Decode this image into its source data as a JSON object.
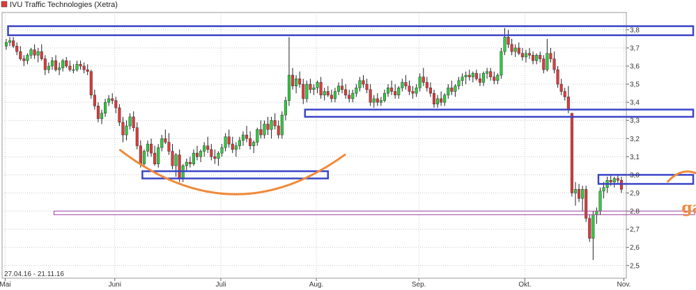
{
  "chart_data": {
    "type": "candlestick",
    "title": "IVU Traffic Technologies (Xetra)",
    "date_range_label": "27.04.16 - 21.11.16",
    "ylim": [
      2.43,
      3.88
    ],
    "y_ticks": [
      2.5,
      2.6,
      2.7,
      2.8,
      2.9,
      3.0,
      3.1,
      3.2,
      3.3,
      3.4,
      3.5,
      3.6,
      3.7,
      3.8
    ],
    "y_tick_labels": [
      "2,5",
      "2,6",
      "2,7",
      "2,8",
      "2,9",
      "3,0",
      "3,1",
      "3,2",
      "3,3",
      "3,4",
      "3,5",
      "3,6",
      "3,7",
      "3,8"
    ],
    "x_months": [
      {
        "label": "Mai",
        "index": 0
      },
      {
        "label": "Juni",
        "index": 31
      },
      {
        "label": "Juli",
        "index": 61
      },
      {
        "label": "Aug.",
        "index": 88
      },
      {
        "label": "Sep.",
        "index": 117
      },
      {
        "label": "Okt.",
        "index": 147
      },
      {
        "label": "Nov.",
        "index": 175
      }
    ],
    "candles": [
      [
        3.71,
        3.75,
        3.69,
        3.73
      ],
      [
        3.73,
        3.76,
        3.71,
        3.74
      ],
      [
        3.74,
        3.76,
        3.7,
        3.71
      ],
      [
        3.71,
        3.73,
        3.66,
        3.68
      ],
      [
        3.68,
        3.71,
        3.63,
        3.64
      ],
      [
        3.64,
        3.66,
        3.6,
        3.63
      ],
      [
        3.63,
        3.67,
        3.61,
        3.66
      ],
      [
        3.66,
        3.7,
        3.64,
        3.69
      ],
      [
        3.69,
        3.72,
        3.64,
        3.66
      ],
      [
        3.66,
        3.7,
        3.62,
        3.68
      ],
      [
        3.68,
        3.72,
        3.63,
        3.64
      ],
      [
        3.64,
        3.66,
        3.55,
        3.58
      ],
      [
        3.58,
        3.62,
        3.56,
        3.6
      ],
      [
        3.6,
        3.65,
        3.58,
        3.63
      ],
      [
        3.63,
        3.66,
        3.57,
        3.58
      ],
      [
        3.58,
        3.62,
        3.55,
        3.59
      ],
      [
        3.59,
        3.64,
        3.57,
        3.63
      ],
      [
        3.63,
        3.65,
        3.59,
        3.6
      ],
      [
        3.6,
        3.63,
        3.57,
        3.58
      ],
      [
        3.58,
        3.61,
        3.56,
        3.58
      ],
      [
        3.58,
        3.63,
        3.57,
        3.61
      ],
      [
        3.61,
        3.63,
        3.58,
        3.6
      ],
      [
        3.6,
        3.62,
        3.56,
        3.58
      ],
      [
        3.58,
        3.61,
        3.55,
        3.57
      ],
      [
        3.57,
        3.58,
        3.42,
        3.44
      ],
      [
        3.44,
        3.47,
        3.36,
        3.38
      ],
      [
        3.38,
        3.4,
        3.29,
        3.31
      ],
      [
        3.31,
        3.36,
        3.28,
        3.34
      ],
      [
        3.34,
        3.42,
        3.32,
        3.4
      ],
      [
        3.4,
        3.44,
        3.38,
        3.42
      ],
      [
        3.42,
        3.45,
        3.39,
        3.41
      ],
      [
        3.41,
        3.43,
        3.34,
        3.37
      ],
      [
        3.37,
        3.39,
        3.27,
        3.29
      ],
      [
        3.29,
        3.32,
        3.18,
        3.22
      ],
      [
        3.22,
        3.3,
        3.19,
        3.27
      ],
      [
        3.27,
        3.34,
        3.25,
        3.32
      ],
      [
        3.32,
        3.35,
        3.24,
        3.26
      ],
      [
        3.26,
        3.29,
        3.14,
        3.16
      ],
      [
        3.16,
        3.19,
        3.04,
        3.06
      ],
      [
        3.06,
        3.14,
        3.04,
        3.13
      ],
      [
        3.13,
        3.19,
        3.1,
        3.17
      ],
      [
        3.17,
        3.2,
        3.1,
        3.12
      ],
      [
        3.12,
        3.16,
        3.05,
        3.06
      ],
      [
        3.06,
        3.17,
        3.04,
        3.15
      ],
      [
        3.15,
        3.22,
        3.13,
        3.2
      ],
      [
        3.2,
        3.25,
        3.17,
        3.18
      ],
      [
        3.18,
        3.23,
        3.11,
        3.13
      ],
      [
        3.13,
        3.17,
        3.03,
        3.05
      ],
      [
        3.05,
        3.12,
        2.99,
        3.11
      ],
      [
        3.11,
        3.14,
        2.96,
        2.98
      ],
      [
        2.98,
        3.06,
        2.96,
        3.05
      ],
      [
        3.05,
        3.09,
        3.02,
        3.07
      ],
      [
        3.07,
        3.1,
        3.04,
        3.06
      ],
      [
        3.06,
        3.14,
        3.05,
        3.12
      ],
      [
        3.12,
        3.16,
        3.08,
        3.1
      ],
      [
        3.1,
        3.14,
        3.07,
        3.13
      ],
      [
        3.13,
        3.18,
        3.1,
        3.16
      ],
      [
        3.16,
        3.21,
        3.12,
        3.14
      ],
      [
        3.14,
        3.17,
        3.08,
        3.1
      ],
      [
        3.1,
        3.14,
        3.06,
        3.09
      ],
      [
        3.09,
        3.13,
        3.05,
        3.12
      ],
      [
        3.12,
        3.17,
        3.1,
        3.15
      ],
      [
        3.15,
        3.23,
        3.13,
        3.21
      ],
      [
        3.21,
        3.25,
        3.15,
        3.17
      ],
      [
        3.17,
        3.21,
        3.12,
        3.14
      ],
      [
        3.14,
        3.18,
        3.1,
        3.16
      ],
      [
        3.16,
        3.21,
        3.14,
        3.19
      ],
      [
        3.19,
        3.24,
        3.16,
        3.22
      ],
      [
        3.22,
        3.27,
        3.18,
        3.2
      ],
      [
        3.2,
        3.24,
        3.14,
        3.16
      ],
      [
        3.16,
        3.19,
        3.12,
        3.18
      ],
      [
        3.18,
        3.26,
        3.16,
        3.25
      ],
      [
        3.25,
        3.3,
        3.2,
        3.22
      ],
      [
        3.22,
        3.3,
        3.2,
        3.28
      ],
      [
        3.28,
        3.32,
        3.22,
        3.25
      ],
      [
        3.25,
        3.32,
        3.2,
        3.3
      ],
      [
        3.3,
        3.34,
        3.25,
        3.27
      ],
      [
        3.27,
        3.3,
        3.2,
        3.22
      ],
      [
        3.22,
        3.35,
        3.2,
        3.33
      ],
      [
        3.33,
        3.43,
        3.3,
        3.41
      ],
      [
        3.41,
        3.76,
        3.38,
        3.55
      ],
      [
        3.55,
        3.59,
        3.47,
        3.49
      ],
      [
        3.49,
        3.55,
        3.45,
        3.53
      ],
      [
        3.53,
        3.57,
        3.48,
        3.5
      ],
      [
        3.5,
        3.53,
        3.39,
        3.42
      ],
      [
        3.42,
        3.52,
        3.4,
        3.5
      ],
      [
        3.5,
        3.53,
        3.45,
        3.47
      ],
      [
        3.47,
        3.5,
        3.44,
        3.48
      ],
      [
        3.48,
        3.52,
        3.45,
        3.51
      ],
      [
        3.51,
        3.54,
        3.42,
        3.44
      ],
      [
        3.44,
        3.48,
        3.41,
        3.46
      ],
      [
        3.46,
        3.49,
        3.43,
        3.44
      ],
      [
        3.44,
        3.47,
        3.4,
        3.42
      ],
      [
        3.42,
        3.48,
        3.4,
        3.46
      ],
      [
        3.46,
        3.51,
        3.44,
        3.49
      ],
      [
        3.49,
        3.53,
        3.45,
        3.47
      ],
      [
        3.47,
        3.5,
        3.42,
        3.44
      ],
      [
        3.44,
        3.47,
        3.4,
        3.42
      ],
      [
        3.42,
        3.47,
        3.4,
        3.45
      ],
      [
        3.45,
        3.5,
        3.43,
        3.48
      ],
      [
        3.48,
        3.54,
        3.46,
        3.52
      ],
      [
        3.52,
        3.55,
        3.48,
        3.5
      ],
      [
        3.5,
        3.53,
        3.45,
        3.47
      ],
      [
        3.47,
        3.5,
        3.38,
        3.4
      ],
      [
        3.4,
        3.44,
        3.37,
        3.42
      ],
      [
        3.42,
        3.45,
        3.38,
        3.4
      ],
      [
        3.4,
        3.43,
        3.38,
        3.41
      ],
      [
        3.41,
        3.47,
        3.4,
        3.45
      ],
      [
        3.45,
        3.5,
        3.43,
        3.48
      ],
      [
        3.48,
        3.52,
        3.44,
        3.46
      ],
      [
        3.46,
        3.5,
        3.42,
        3.44
      ],
      [
        3.44,
        3.49,
        3.42,
        3.48
      ],
      [
        3.48,
        3.53,
        3.46,
        3.51
      ],
      [
        3.51,
        3.55,
        3.47,
        3.49
      ],
      [
        3.49,
        3.52,
        3.44,
        3.46
      ],
      [
        3.46,
        3.49,
        3.42,
        3.45
      ],
      [
        3.45,
        3.5,
        3.43,
        3.48
      ],
      [
        3.48,
        3.56,
        3.46,
        3.54
      ],
      [
        3.54,
        3.59,
        3.49,
        3.51
      ],
      [
        3.51,
        3.54,
        3.46,
        3.48
      ],
      [
        3.48,
        3.51,
        3.43,
        3.45
      ],
      [
        3.45,
        3.47,
        3.37,
        3.39
      ],
      [
        3.39,
        3.44,
        3.37,
        3.42
      ],
      [
        3.42,
        3.46,
        3.38,
        3.4
      ],
      [
        3.4,
        3.45,
        3.38,
        3.44
      ],
      [
        3.44,
        3.5,
        3.42,
        3.48
      ],
      [
        3.48,
        3.52,
        3.44,
        3.46
      ],
      [
        3.46,
        3.5,
        3.43,
        3.49
      ],
      [
        3.49,
        3.54,
        3.47,
        3.52
      ],
      [
        3.52,
        3.56,
        3.49,
        3.54
      ],
      [
        3.54,
        3.57,
        3.5,
        3.55
      ],
      [
        3.55,
        3.58,
        3.52,
        3.54
      ],
      [
        3.54,
        3.57,
        3.51,
        3.56
      ],
      [
        3.56,
        3.58,
        3.52,
        3.53
      ],
      [
        3.53,
        3.56,
        3.49,
        3.51
      ],
      [
        3.51,
        3.57,
        3.49,
        3.56
      ],
      [
        3.56,
        3.59,
        3.53,
        3.57
      ],
      [
        3.57,
        3.59,
        3.52,
        3.54
      ],
      [
        3.54,
        3.57,
        3.5,
        3.52
      ],
      [
        3.52,
        3.56,
        3.5,
        3.55
      ],
      [
        3.55,
        3.7,
        3.53,
        3.68
      ],
      [
        3.68,
        3.81,
        3.66,
        3.76
      ],
      [
        3.76,
        3.8,
        3.7,
        3.72
      ],
      [
        3.72,
        3.75,
        3.66,
        3.68
      ],
      [
        3.68,
        3.72,
        3.65,
        3.7
      ],
      [
        3.7,
        3.73,
        3.66,
        3.67
      ],
      [
        3.67,
        3.7,
        3.63,
        3.65
      ],
      [
        3.65,
        3.69,
        3.62,
        3.67
      ],
      [
        3.67,
        3.7,
        3.64,
        3.66
      ],
      [
        3.66,
        3.68,
        3.61,
        3.63
      ],
      [
        3.63,
        3.67,
        3.61,
        3.66
      ],
      [
        3.66,
        3.68,
        3.62,
        3.64
      ],
      [
        3.64,
        3.66,
        3.56,
        3.58
      ],
      [
        3.58,
        3.75,
        3.57,
        3.67
      ],
      [
        3.67,
        3.7,
        3.62,
        3.64
      ],
      [
        3.64,
        3.68,
        3.56,
        3.58
      ],
      [
        3.58,
        3.6,
        3.48,
        3.5
      ],
      [
        3.5,
        3.53,
        3.44,
        3.46
      ],
      [
        3.46,
        3.48,
        3.41,
        3.43
      ],
      [
        3.43,
        3.49,
        3.34,
        3.36
      ],
      [
        3.34,
        3.34,
        2.88,
        2.9
      ],
      [
        2.9,
        2.96,
        2.83,
        2.92
      ],
      [
        2.92,
        2.95,
        2.85,
        2.87
      ],
      [
        2.87,
        2.94,
        2.8,
        2.92
      ],
      [
        2.92,
        2.94,
        2.74,
        2.76
      ],
      [
        2.76,
        2.78,
        2.63,
        2.65
      ],
      [
        2.65,
        2.8,
        2.53,
        2.78
      ],
      [
        2.78,
        2.82,
        2.73,
        2.8
      ],
      [
        2.8,
        2.93,
        2.78,
        2.91
      ],
      [
        2.91,
        2.96,
        2.87,
        2.93
      ],
      [
        2.93,
        2.99,
        2.9,
        2.97
      ],
      [
        2.97,
        3.0,
        2.94,
        2.96
      ],
      [
        2.96,
        2.99,
        2.93,
        2.98
      ],
      [
        2.98,
        3.0,
        2.95,
        2.97
      ],
      [
        2.97,
        2.99,
        2.9,
        2.92
      ]
    ]
  },
  "overlays": {
    "colors": {
      "up": "#2ecc40",
      "down": "#e03a3a",
      "frame": "#3a44c8",
      "trend": "#f08a3a",
      "gap_line": "#a040a0",
      "grid": "#c8c8c8"
    },
    "annotation_text": "gap"
  }
}
